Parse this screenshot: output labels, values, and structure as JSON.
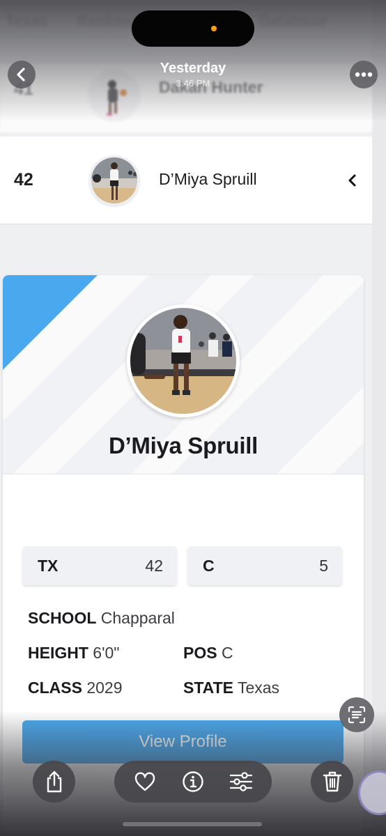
{
  "background_nav": [
    "Texas",
    "Rankings",
    "Database"
  ],
  "rows": [
    {
      "rank": "41",
      "name": "Dakan Hunter"
    },
    {
      "rank": "42",
      "name": "D’Miya Spruill"
    }
  ],
  "profile": {
    "name": "D’Miya Spruill",
    "stats": [
      {
        "key": "TX",
        "value": "42"
      },
      {
        "key": "C",
        "value": "5"
      }
    ],
    "school_label": "SCHOOL",
    "school_value": "Chapparal",
    "height_label": "HEIGHT",
    "height_value": "6'0\"",
    "pos_label": "POS",
    "pos_value": "C",
    "class_label": "CLASS",
    "class_value": "2029",
    "state_label": "STATE",
    "state_value": "Texas",
    "view_button": "View Profile"
  },
  "viewer": {
    "title": "Yesterday",
    "time": "3:46 PM"
  },
  "colors": {
    "accent_blue": "#4aa9ee",
    "banner_stripe": "#4aa9ee",
    "camera_dot": "#ff9f1a"
  },
  "icons": [
    "chevron-left-icon",
    "ellipsis-icon",
    "live-text-icon",
    "share-icon",
    "heart-icon",
    "info-icon",
    "sliders-icon",
    "trash-icon"
  ]
}
